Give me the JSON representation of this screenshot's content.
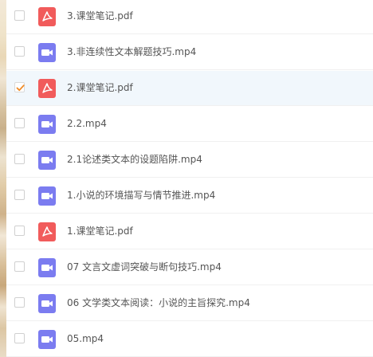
{
  "files": [
    {
      "name": "3.课堂笔记.pdf",
      "type": "pdf",
      "icon": "pdf-file-icon",
      "checked": false
    },
    {
      "name": "3.非连续性文本解题技巧.mp4",
      "type": "video",
      "icon": "video-file-icon",
      "checked": false
    },
    {
      "name": "2.课堂笔记.pdf",
      "type": "pdf",
      "icon": "pdf-file-icon",
      "checked": true
    },
    {
      "name": "2.2.mp4",
      "type": "video",
      "icon": "video-file-icon",
      "checked": false
    },
    {
      "name": "2.1论述类文本的设题陷阱.mp4",
      "type": "video",
      "icon": "video-file-icon",
      "checked": false
    },
    {
      "name": "1.小说的环境描写与情节推进.mp4",
      "type": "video",
      "icon": "video-file-icon",
      "checked": false
    },
    {
      "name": "1.课堂笔记.pdf",
      "type": "pdf",
      "icon": "pdf-file-icon",
      "checked": false
    },
    {
      "name": "07 文言文虚词突破与断句技巧.mp4",
      "type": "video",
      "icon": "video-file-icon",
      "checked": false
    },
    {
      "name": "06 文学类文本阅读：小说的主旨探究.mp4",
      "type": "video",
      "icon": "video-file-icon",
      "checked": false
    },
    {
      "name": "05.mp4",
      "type": "video",
      "icon": "video-file-icon",
      "checked": false
    }
  ],
  "colors": {
    "pdf_icon": "#f15b5b",
    "video_icon": "#7b7cf0",
    "checkmark": "#f08a24",
    "selected_row": "#f1f7fc",
    "text": "#555555"
  }
}
